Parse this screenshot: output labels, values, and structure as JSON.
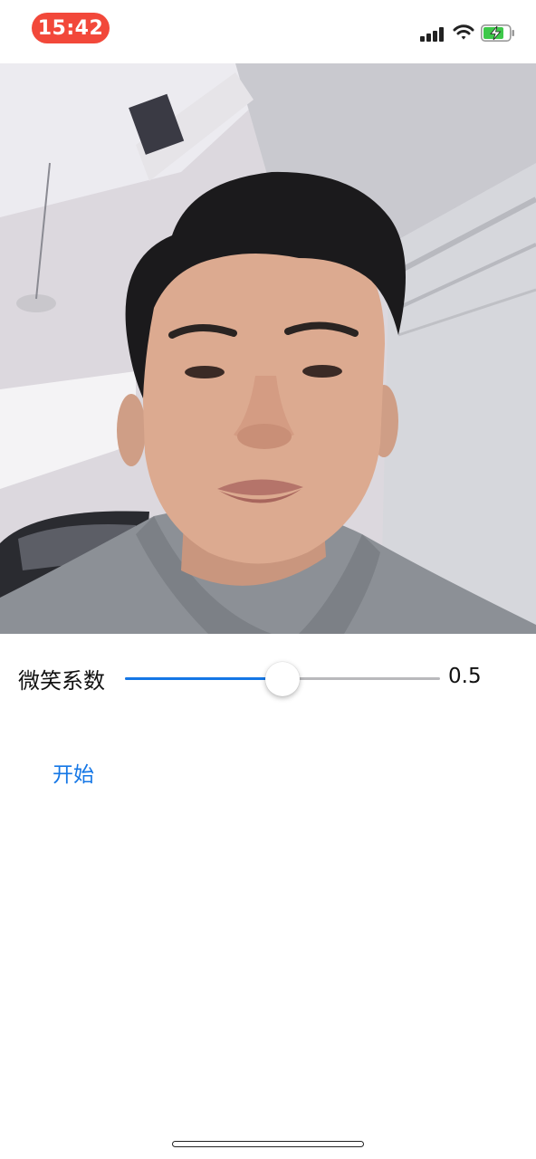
{
  "status_bar": {
    "time": "15:42",
    "time_pill_color": "#f2483a",
    "icons": [
      "cellular-signal-icon",
      "wifi-icon",
      "battery-charging-icon"
    ]
  },
  "camera": {
    "description_colors": {
      "wall": "#d3d3da",
      "hair": "#1b1a1c",
      "skin": "#d9a88e",
      "hoodie": "#8c9096"
    }
  },
  "slider": {
    "label": "微笑系数",
    "value_text": "0.5",
    "value": 0.5,
    "min": 0,
    "max": 1,
    "fill_color": "#1577e6"
  },
  "start_button": {
    "label": "开始",
    "color": "#1577e6"
  }
}
